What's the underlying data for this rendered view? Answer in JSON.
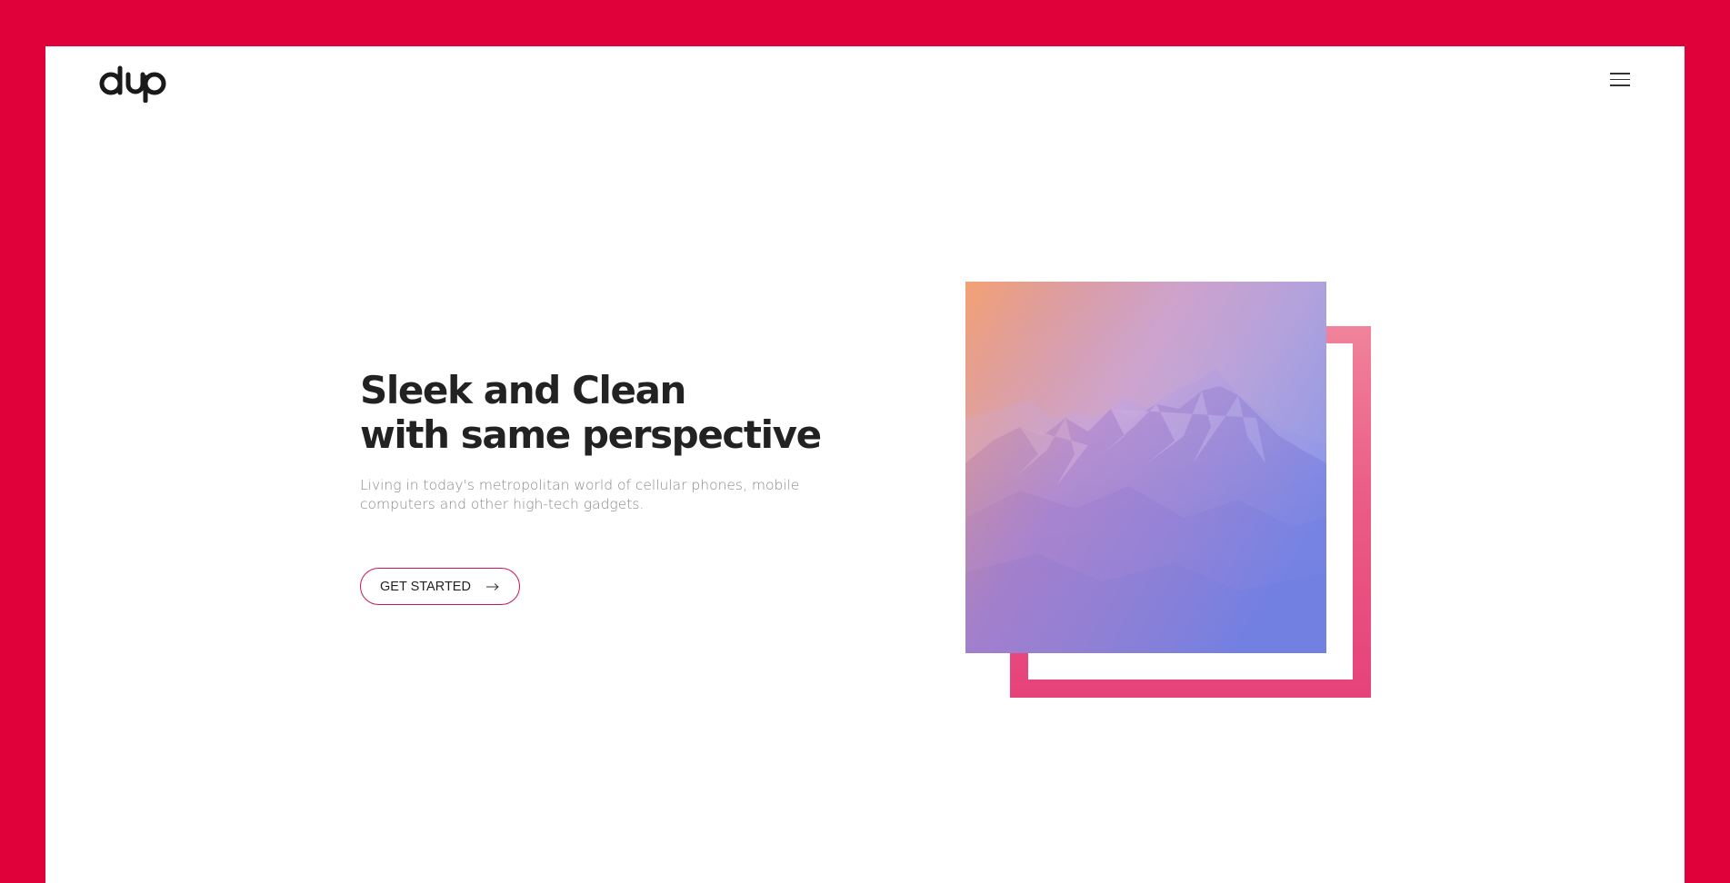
{
  "brand": {
    "logo_text": "dup",
    "frame_color": "#e0003a",
    "accent": "#c2185b"
  },
  "nav": {
    "menu_icon": "hamburger-menu-icon"
  },
  "hero": {
    "title_line1": "Sleek and Clean",
    "title_line2": "with same perspective",
    "description": "Living in today's metropolitan world of cellular phones, mobile computers and other high-tech gadgets.",
    "cta_label": "GET STARTED",
    "cta_icon": "arrow-right-icon"
  },
  "image": {
    "subject": "mountain-landscape-photo",
    "gradient_colors": [
      "#f7b48c",
      "#8f86d8",
      "#6d7fe0"
    ],
    "frame_color": "#eb5d86"
  }
}
